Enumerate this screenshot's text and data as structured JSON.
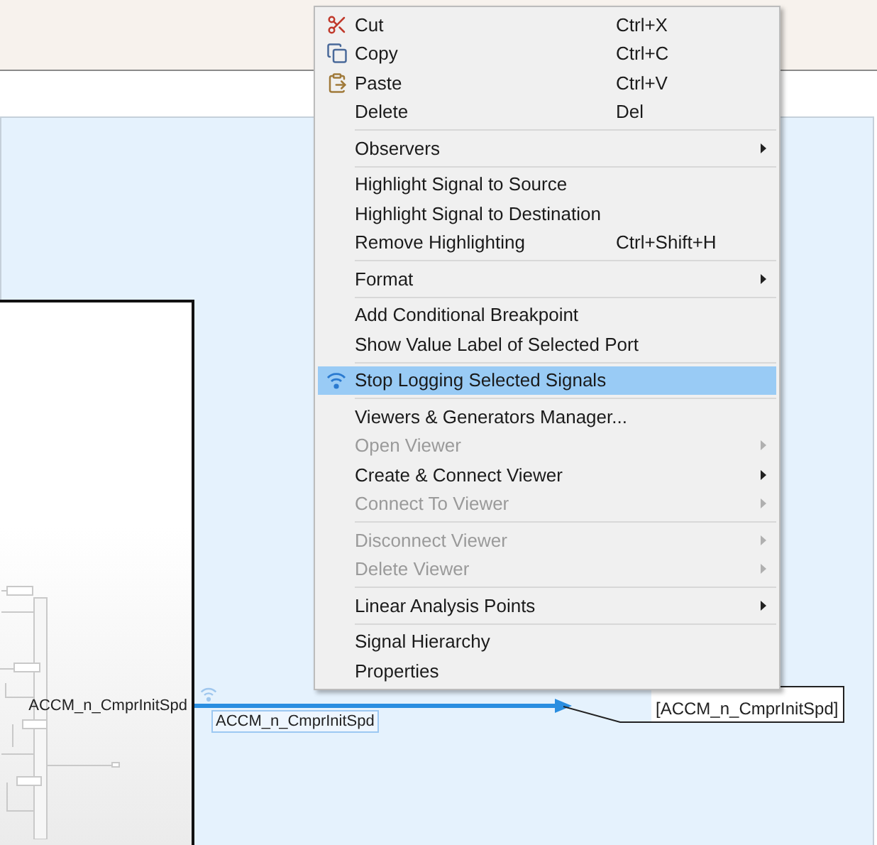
{
  "canvas": {
    "block": {
      "port_label": "ACCM_n_CmprInitSpd"
    },
    "signal": {
      "label": "ACCM_n_CmprInitSpd",
      "logged": true,
      "selected": true
    },
    "goto_tag": {
      "label": "[ACCM_n_CmprInitSpd]"
    }
  },
  "context_menu": {
    "items": [
      {
        "kind": "item",
        "label": "Cut",
        "shortcut": "Ctrl+X",
        "disabled": false,
        "submenu": false,
        "selected": false
      },
      {
        "kind": "item",
        "label": "Copy",
        "shortcut": "Ctrl+C",
        "disabled": false,
        "submenu": false,
        "selected": false
      },
      {
        "kind": "item",
        "label": "Paste",
        "shortcut": "Ctrl+V",
        "disabled": false,
        "submenu": false,
        "selected": false
      },
      {
        "kind": "item",
        "label": "Delete",
        "shortcut": "Del",
        "disabled": false,
        "submenu": false,
        "selected": false
      },
      {
        "kind": "separator"
      },
      {
        "kind": "item",
        "label": "Observers",
        "disabled": false,
        "submenu": true,
        "selected": false
      },
      {
        "kind": "separator"
      },
      {
        "kind": "item",
        "label": "Highlight Signal to Source",
        "disabled": false,
        "submenu": false,
        "selected": false
      },
      {
        "kind": "item",
        "label": "Highlight Signal to Destination",
        "disabled": false,
        "submenu": false,
        "selected": false
      },
      {
        "kind": "item",
        "label": "Remove Highlighting",
        "shortcut": "Ctrl+Shift+H",
        "disabled": false,
        "submenu": false,
        "selected": false
      },
      {
        "kind": "separator"
      },
      {
        "kind": "item",
        "label": "Format",
        "disabled": false,
        "submenu": true,
        "selected": false
      },
      {
        "kind": "separator"
      },
      {
        "kind": "item",
        "label": "Add Conditional Breakpoint",
        "disabled": false,
        "submenu": false,
        "selected": false
      },
      {
        "kind": "item",
        "label": "Show Value Label of Selected Port",
        "disabled": false,
        "submenu": false,
        "selected": false
      },
      {
        "kind": "separator"
      },
      {
        "kind": "item",
        "label": "Stop Logging Selected Signals",
        "disabled": false,
        "submenu": false,
        "selected": true
      },
      {
        "kind": "separator"
      },
      {
        "kind": "item",
        "label": "Viewers & Generators Manager...",
        "disabled": false,
        "submenu": false,
        "selected": false
      },
      {
        "kind": "item",
        "label": "Open Viewer",
        "disabled": true,
        "submenu": true,
        "selected": false
      },
      {
        "kind": "item",
        "label": "Create & Connect Viewer",
        "disabled": false,
        "submenu": true,
        "selected": false
      },
      {
        "kind": "item",
        "label": "Connect To Viewer",
        "disabled": true,
        "submenu": true,
        "selected": false
      },
      {
        "kind": "separator"
      },
      {
        "kind": "item",
        "label": "Disconnect Viewer",
        "disabled": true,
        "submenu": true,
        "selected": false
      },
      {
        "kind": "item",
        "label": "Delete Viewer",
        "disabled": true,
        "submenu": true,
        "selected": false
      },
      {
        "kind": "separator"
      },
      {
        "kind": "item",
        "label": "Linear Analysis Points",
        "disabled": false,
        "submenu": true,
        "selected": false
      },
      {
        "kind": "separator"
      },
      {
        "kind": "item",
        "label": "Signal Hierarchy",
        "disabled": false,
        "submenu": false,
        "selected": false
      },
      {
        "kind": "item",
        "label": "Properties",
        "disabled": false,
        "submenu": false,
        "selected": false
      }
    ]
  }
}
